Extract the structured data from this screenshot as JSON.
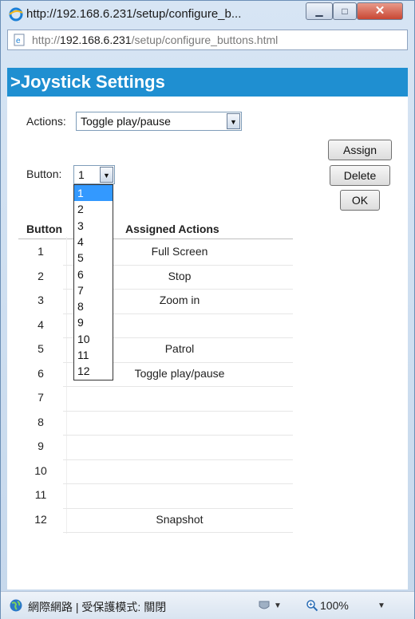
{
  "window": {
    "title": "http://192.168.6.231/setup/configure_b...",
    "close_glyph": "✕"
  },
  "address": {
    "prefix": "http://",
    "host": "192.168.6.231",
    "path": "/setup/configure_buttons.html"
  },
  "page": {
    "header": ">Joystick Settings",
    "actions_label": "Actions:",
    "actions_value": "Toggle play/pause",
    "button_label": "Button:",
    "button_value": "1",
    "buttons": {
      "assign": "Assign",
      "delete": "Delete",
      "ok": "OK"
    },
    "dropdown_options": [
      "1",
      "2",
      "3",
      "4",
      "5",
      "6",
      "7",
      "8",
      "9",
      "10",
      "11",
      "12"
    ],
    "table": {
      "col_button": "Button",
      "col_actions": "Assigned Actions",
      "rows": [
        {
          "button": "1",
          "action": "Full Screen"
        },
        {
          "button": "2",
          "action": "Stop"
        },
        {
          "button": "3",
          "action": "Zoom in"
        },
        {
          "button": "4",
          "action": ""
        },
        {
          "button": "5",
          "action": "Patrol"
        },
        {
          "button": "6",
          "action": "Toggle play/pause"
        },
        {
          "button": "7",
          "action": ""
        },
        {
          "button": "8",
          "action": ""
        },
        {
          "button": "9",
          "action": ""
        },
        {
          "button": "10",
          "action": ""
        },
        {
          "button": "11",
          "action": ""
        },
        {
          "button": "12",
          "action": "Snapshot"
        }
      ]
    }
  },
  "status": {
    "zone_text": "網際網路 | 受保護模式: 關閉",
    "zoom": "100%"
  },
  "colors": {
    "accent": "#1f8fd1",
    "selected": "#3399ff"
  }
}
